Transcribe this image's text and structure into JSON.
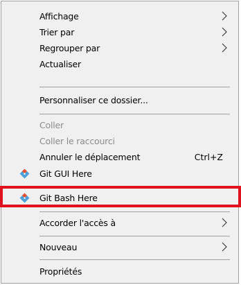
{
  "context_menu": {
    "items": [
      {
        "label": "Affichage",
        "submenu": true
      },
      {
        "label": "Trier par",
        "submenu": true
      },
      {
        "label": "Regrouper par",
        "submenu": true
      },
      {
        "label": "Actualiser"
      },
      {
        "label": "Personnaliser ce dossier..."
      },
      {
        "label": "Coller",
        "disabled": true
      },
      {
        "label": "Coller le raccourci",
        "disabled": true
      },
      {
        "label": "Annuler le déplacement",
        "shortcut": "Ctrl+Z"
      },
      {
        "label": "Git GUI Here",
        "icon": "git-gui-icon"
      },
      {
        "label": "Git Bash Here",
        "icon": "git-bash-icon",
        "highlighted": true
      },
      {
        "label": "Accorder l'accès à",
        "submenu": true
      },
      {
        "label": "Nouveau",
        "submenu": true
      },
      {
        "label": "Propriétés"
      }
    ]
  },
  "colors": {
    "menu_background": "#f0f0f0",
    "separator": "#a0a0a0",
    "disabled_text": "#8b8b8b",
    "highlight_border": "#e0121e",
    "git_icon_orange": "#e8502f",
    "git_icon_blue": "#4e9ed8"
  }
}
